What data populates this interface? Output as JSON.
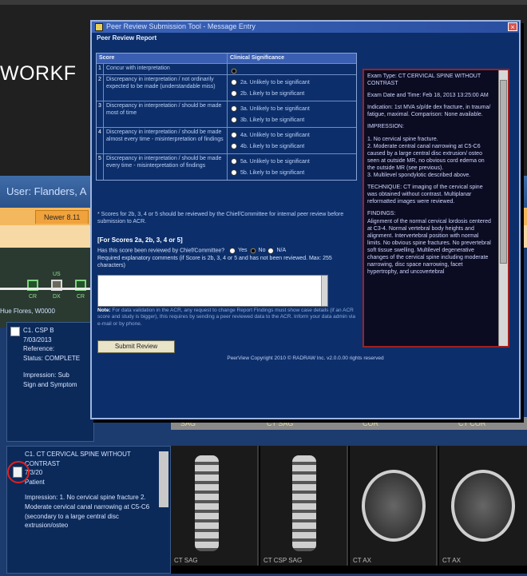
{
  "slide": {
    "title": "WORKF"
  },
  "background_app": {
    "header_title": "User: Flanders, A",
    "tab_label": "Newer 8.11",
    "status_labels": [
      "CR",
      "DX",
      "CR",
      "US"
    ],
    "status_caption": "Hue Flores, W0000",
    "row1": {
      "lines": [
        "C1. CSP B",
        "7/03/2013",
        "Reference:",
        "Status: COMPLETE",
        "",
        "Impression: Sub",
        "Sign and Symptom"
      ]
    },
    "row2": {
      "lines": [
        "C1. CT CERVICAL SPINE WITHOUT",
        "CONTRAST",
        "7/3/20",
        "Patient"
      ],
      "impression": "Impression: 1. No cervical spine fracture 2. Moderate cervical canal narrowing at C5-C6 (secondary to a large central disc extrusion/osteo"
    },
    "series_labels": [
      "SAG",
      "CT SAG",
      "COR",
      "CT COR"
    ],
    "thumb_labels": [
      "CT SAG",
      "CT CSP SAG",
      "CT AX",
      "CT AX"
    ]
  },
  "popup": {
    "window_title": "Peer Review Submission Tool - Message Entry",
    "subtitle": "Peer Review Report",
    "table": {
      "col_score": "Score",
      "col_significance": "Clinical Significance",
      "rows": [
        {
          "num": "1",
          "score": "Concur with interpretation",
          "options": []
        },
        {
          "num": "2",
          "score": "Discrepancy in interpretation / not ordinarily expected to be made (understandable miss)",
          "options": [
            "2a. Unlikely to be significant",
            "2b. Likely to be significant"
          ]
        },
        {
          "num": "3",
          "score": "Discrepancy in interpretation / should be made most of time",
          "options": [
            "3a. Unlikely to be significant",
            "3b. Likely to be significant"
          ]
        },
        {
          "num": "4",
          "score": "Discrepancy in interpretation / should be made almost every time - misinterpretation of findings",
          "options": [
            "4a. Unlikely to be significant",
            "4b. Likely to be significant"
          ]
        },
        {
          "num": "5",
          "score": "Discrepancy in interpretation / should be made every time - misinterpretation of findings",
          "options": [
            "5a. Unlikely to be significant",
            "5b. Likely to be significant"
          ]
        }
      ]
    },
    "table_note": "* Scores for 2b, 3, 4 or 5 should be reviewed by the Chief/Committee for internal peer review before submission to ACR.",
    "section_title": "[For Scores 2a, 2b, 3, 4 or 5]",
    "question": "Has this score been reviewed by Chief/Committee?",
    "q_options": [
      "Yes",
      "No",
      "N/A"
    ],
    "comment_prompt": "Required explanatory comments (if Score is 2b, 3, 4 or 5 and has not been reviewed. Max: 255 characters)",
    "note_label": "Note:",
    "note_text": "For data validation in the ACR, any request to change Report Findings must show case details (if an ACR score and study is bigger), this requires by sending a peer reviewed data to the ACR. Inform your data admin via e-mail or by phone.",
    "submit_label": "Submit Review",
    "footer": "PeerView Copyright 2010 © RADRAW Inc. v2.0.0.00 rights reserved",
    "report_paragraphs": [
      "Exam Type: CT CERVICAL SPINE WITHOUT CONTRAST",
      "Exam Date and Time: Feb 18, 2013 13:25:00 AM",
      "Indication: 1st MVA s/p/de dex fracture, in trauma/ fatigue, maximal. Comparison: None available.",
      "IMPRESSION:",
      "1. No cervical spine fracture.\n2. Moderate central canal narrowing at C5-C6 caused by a large central disc extrusion/ osteo seen at outside MR, no obvious cord edema on the outside MR (see previous).\n3. Multilevel spondylotic described above.",
      "TECHNIQUE: CT imaging of the cervical spine was obtained without contrast. Multiplanar reformatted images were reviewed.",
      "FINDINGS:\nAlignment of the normal cervical lordosis centered at C3-4. Normal vertebral body heights and alignment. Intervertebral position with normal limits. No obvious spine fractures. No prevertebral soft tissue swelling. Multilevel degenerative changes of the cervical spine including moderate narrowing, disc space narrowing, facet hypertrophy, and uncovertebral"
    ]
  }
}
